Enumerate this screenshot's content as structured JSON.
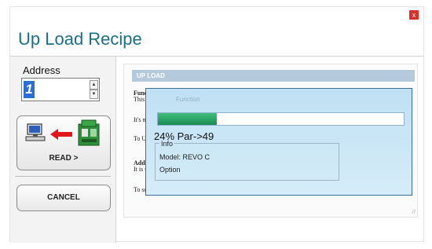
{
  "window": {
    "title": "Up Load Recipe",
    "close_glyph": "x"
  },
  "address": {
    "label": "Address",
    "value": "1",
    "spin_up": "▲",
    "spin_down": "▼"
  },
  "buttons": {
    "read_label": "READ >",
    "cancel_label": "CANCEL"
  },
  "icons": {
    "pc": "computer-icon",
    "arrow": "left-arrow-icon",
    "module": "module-icon"
  },
  "doc": {
    "header": "UP LOAD",
    "line1": "Funct",
    "line2": "This fu",
    "line3": "It's ne",
    "line4": "To Up",
    "line5": "Addre",
    "line6": "It is u",
    "line7": "To set",
    "grip": "//"
  },
  "progress": {
    "ghost_label": "Function",
    "status": "24% Par->49",
    "fraction": 0.24,
    "info_title": "Info",
    "model": "Model: REVO C",
    "option": "Option"
  },
  "colors": {
    "title": "#1a6e8e",
    "progress_fill": "#1b8a52",
    "close": "#d9302b"
  }
}
